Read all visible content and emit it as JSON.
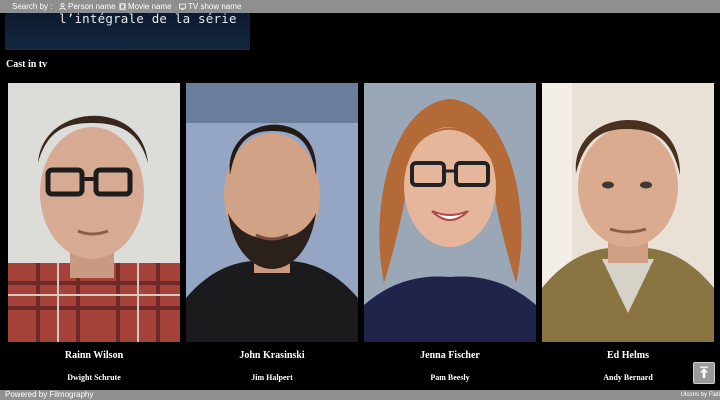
{
  "search": {
    "label": "Search by :",
    "options": [
      {
        "label": "Person name",
        "icon": "person-icon"
      },
      {
        "label": "Movie name",
        "icon": "film-icon"
      },
      {
        "label": "TV show name",
        "icon": "tv-icon"
      }
    ]
  },
  "banner": {
    "text": "l’intégrale de la série"
  },
  "cast": {
    "title": "Cast in tv",
    "members": [
      {
        "actor": "Rainn Wilson",
        "character": "Dwight Schrute"
      },
      {
        "actor": "John Krasinski",
        "character": "Jim Halpert"
      },
      {
        "actor": "Jenna Fischer",
        "character": "Pam Beesly"
      },
      {
        "actor": "Ed Helms",
        "character": "Andy Bernard"
      }
    ]
  },
  "scroll_top": {
    "icon": "arrow-up-icon"
  },
  "footer": {
    "powered": "Powered by Filmography",
    "credits": "Ulcons by Flati"
  },
  "colors": {
    "bar": "#8f8f8f",
    "background": "#000000"
  }
}
